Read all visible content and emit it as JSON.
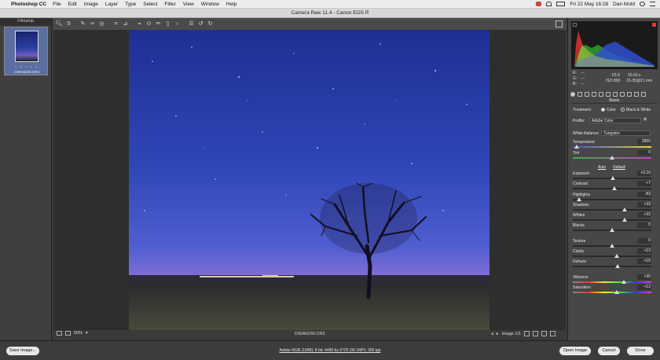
{
  "menubar": {
    "app_name": "Photoshop CC",
    "items": [
      "File",
      "Edit",
      "Image",
      "Layer",
      "Type",
      "Select",
      "Filter",
      "View",
      "Window",
      "Help"
    ],
    "datetime": "Fri 22 May 16:28",
    "user": "Dan Mold"
  },
  "window": {
    "title": "Camera Raw 11.4  -  Canon EOS R"
  },
  "filmstrip": {
    "header": "Filmstrip",
    "items": [
      {
        "name": "O30A0230.CR3",
        "stars": "• • • • •"
      }
    ]
  },
  "canvas": {
    "filename": "O30A0230.CR3",
    "zoom": "50%",
    "image_nav": "Image 1/1"
  },
  "info": {
    "r_label": "R:",
    "r_val": "---",
    "g_label": "G:",
    "g_val": "---",
    "b_label": "B:",
    "b_val": "---",
    "aperture": "f/2.8",
    "shutter": "30.00 s",
    "iso": "ISO 800",
    "lens": "15-35@21 mm"
  },
  "panel": {
    "title": "Basic",
    "treatment_label": "Treatment:",
    "treatment_color": "Color",
    "treatment_bw": "Black & White",
    "profile_label": "Profile:",
    "profile_value": "Adobe Color",
    "wb_label": "White Balance:",
    "wb_value": "Tungsten",
    "auto_label": "Auto",
    "default_label": "Default",
    "sliders": [
      {
        "key": "temperature",
        "label": "Temperature",
        "value": "2850",
        "pos": 0.05
      },
      {
        "key": "tint",
        "label": "Tint",
        "value": "0",
        "pos": 0.5
      },
      {
        "key": "exposure",
        "label": "Exposure",
        "value": "+0.10",
        "pos": 0.51
      },
      {
        "key": "contrast",
        "label": "Contrast",
        "value": "+7",
        "pos": 0.53
      },
      {
        "key": "highlights",
        "label": "Highlights",
        "value": "-83",
        "pos": 0.08
      },
      {
        "key": "shadows",
        "label": "Shadows",
        "value": "+33",
        "pos": 0.66
      },
      {
        "key": "whites",
        "label": "Whites",
        "value": "+32",
        "pos": 0.66
      },
      {
        "key": "blacks",
        "label": "Blacks",
        "value": "0",
        "pos": 0.5
      },
      {
        "key": "texture",
        "label": "Texture",
        "value": "0",
        "pos": 0.5
      },
      {
        "key": "clarity",
        "label": "Clarity",
        "value": "+13",
        "pos": 0.56
      },
      {
        "key": "dehaze",
        "label": "Dehaze",
        "value": "+15",
        "pos": 0.57
      },
      {
        "key": "vibrance",
        "label": "Vibrance",
        "value": "+30",
        "pos": 0.65
      },
      {
        "key": "saturation",
        "label": "Saturation",
        "value": "+12",
        "pos": 0.56
      }
    ]
  },
  "bottom": {
    "save_label": "Save Image...",
    "workflow": "Adobe RGB (1998); 8 bit; 4480 by 6720 (30.1MP); 300 ppi",
    "open_label": "Open Image",
    "cancel_label": "Cancel",
    "done_label": "Done"
  },
  "colors": {
    "accent_clip": "#e33333",
    "sky_top": "#2a3ea8",
    "sky_bottom": "#7860c0"
  }
}
